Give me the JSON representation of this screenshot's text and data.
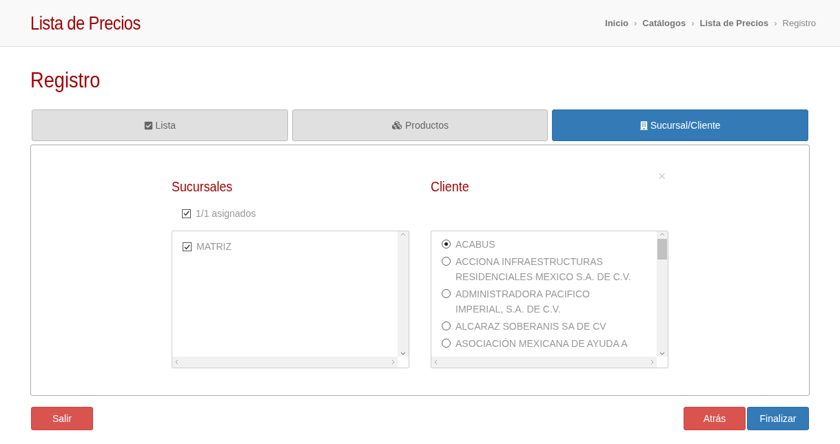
{
  "header": {
    "title": "Lista de Precios",
    "breadcrumb": [
      "Inicio",
      "Catálogos",
      "Lista de Precios",
      "Registro"
    ],
    "separator": "›"
  },
  "page_title": "Registro",
  "tabs": [
    {
      "label": "Lista",
      "kind": "check",
      "selected": false
    },
    {
      "label": "Productos",
      "kind": "cubes",
      "selected": false
    },
    {
      "label": "Sucursal/Cliente",
      "kind": "building",
      "selected": true
    }
  ],
  "sucursales": {
    "title": "Sucursales",
    "select_all": {
      "label": "1/1 asignados",
      "checked": true
    },
    "items": [
      {
        "label": "MATRIZ",
        "checked": true
      }
    ]
  },
  "cliente": {
    "title": "Cliente",
    "close": "×",
    "items": [
      {
        "label": "ACABUS",
        "selected": true
      },
      {
        "label": "ACCIONA INFRAESTRUCTURAS RESIDENCIALES MEXICO S.A. DE C.V.",
        "selected": false
      },
      {
        "label": "ADMINISTRADORA PACIFICO IMPERIAL, S.A. DE C.V.",
        "selected": false
      },
      {
        "label": "ALCARAZ SOBERANIS SA DE CV",
        "selected": false
      },
      {
        "label": "ASOCIACIÓN MEXICANA DE AYUDA A",
        "selected": false
      }
    ]
  },
  "buttons": {
    "left": [
      {
        "label": "Salir",
        "kind": "danger"
      }
    ],
    "right": [
      {
        "label": "Atrás",
        "kind": "danger"
      },
      {
        "label": "Finalizar",
        "kind": "primary"
      }
    ]
  }
}
